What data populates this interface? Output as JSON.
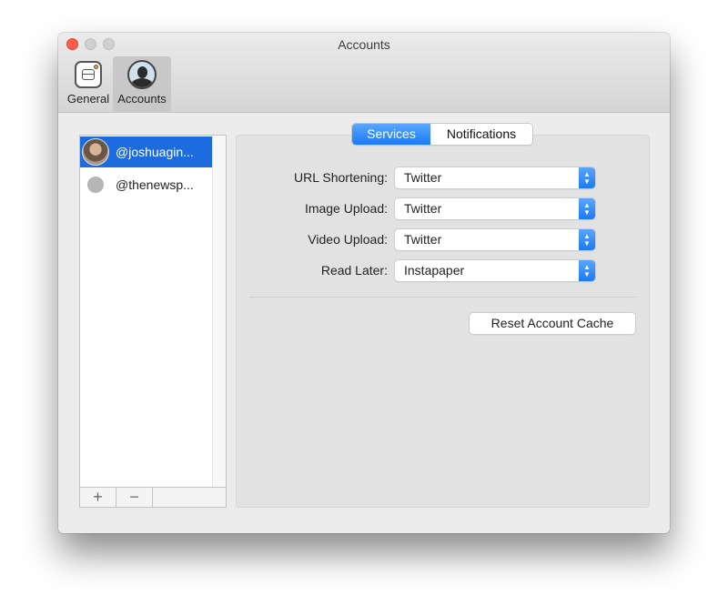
{
  "window": {
    "title": "Accounts"
  },
  "toolbar": {
    "items": [
      {
        "label": "General",
        "icon": "general-icon",
        "selected": false
      },
      {
        "label": "Accounts",
        "icon": "accounts-icon",
        "selected": true
      }
    ]
  },
  "accounts_list": {
    "items": [
      {
        "name": "@joshuagin...",
        "avatar": "photo",
        "selected": true
      },
      {
        "name": "@thenewsp...",
        "avatar": "gray-dot",
        "selected": false
      }
    ],
    "add_label": "+",
    "remove_label": "−"
  },
  "tabs": [
    {
      "label": "Services",
      "active": true
    },
    {
      "label": "Notifications",
      "active": false
    }
  ],
  "services": {
    "rows": [
      {
        "label": "URL Shortening:",
        "value": "Twitter"
      },
      {
        "label": "Image Upload:",
        "value": "Twitter"
      },
      {
        "label": "Video Upload:",
        "value": "Twitter"
      },
      {
        "label": "Read Later:",
        "value": "Instapaper"
      }
    ],
    "reset_label": "Reset Account Cache"
  },
  "colors": {
    "accent": "#1b7af5",
    "selection": "#1c6ce0",
    "close": "#fc5d4c"
  }
}
